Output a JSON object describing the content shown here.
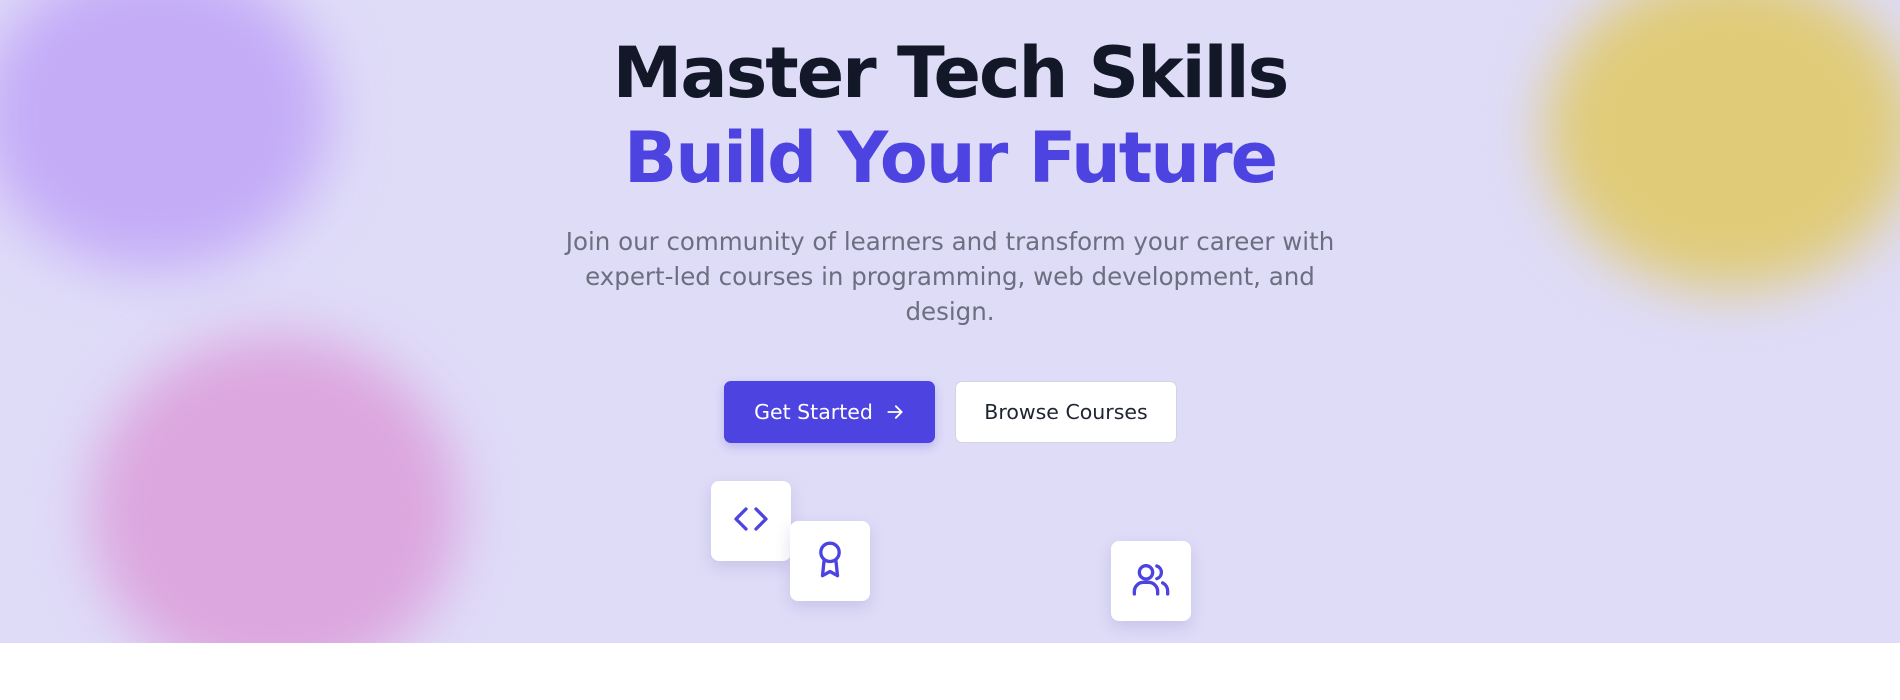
{
  "hero": {
    "title_line1": "Master Tech Skills",
    "title_line2": "Build Your Future",
    "subtitle": "Join our community of learners and transform your career with expert-led courses in programming, web development, and design.",
    "primary_button": "Get Started",
    "secondary_button": "Browse Courses"
  },
  "icons": {
    "primary_button_icon": "arrow-right-icon",
    "floating": [
      "code-icon",
      "award-icon",
      "users-icon"
    ]
  },
  "colors": {
    "accent": "#4c43e0",
    "heading": "#121828",
    "body_text": "#6b6f80",
    "hero_background": "#dfdcf8",
    "blob_purple": "#c4acf7",
    "blob_pink": "#dca6de",
    "blob_yellow": "#dfcb78"
  }
}
